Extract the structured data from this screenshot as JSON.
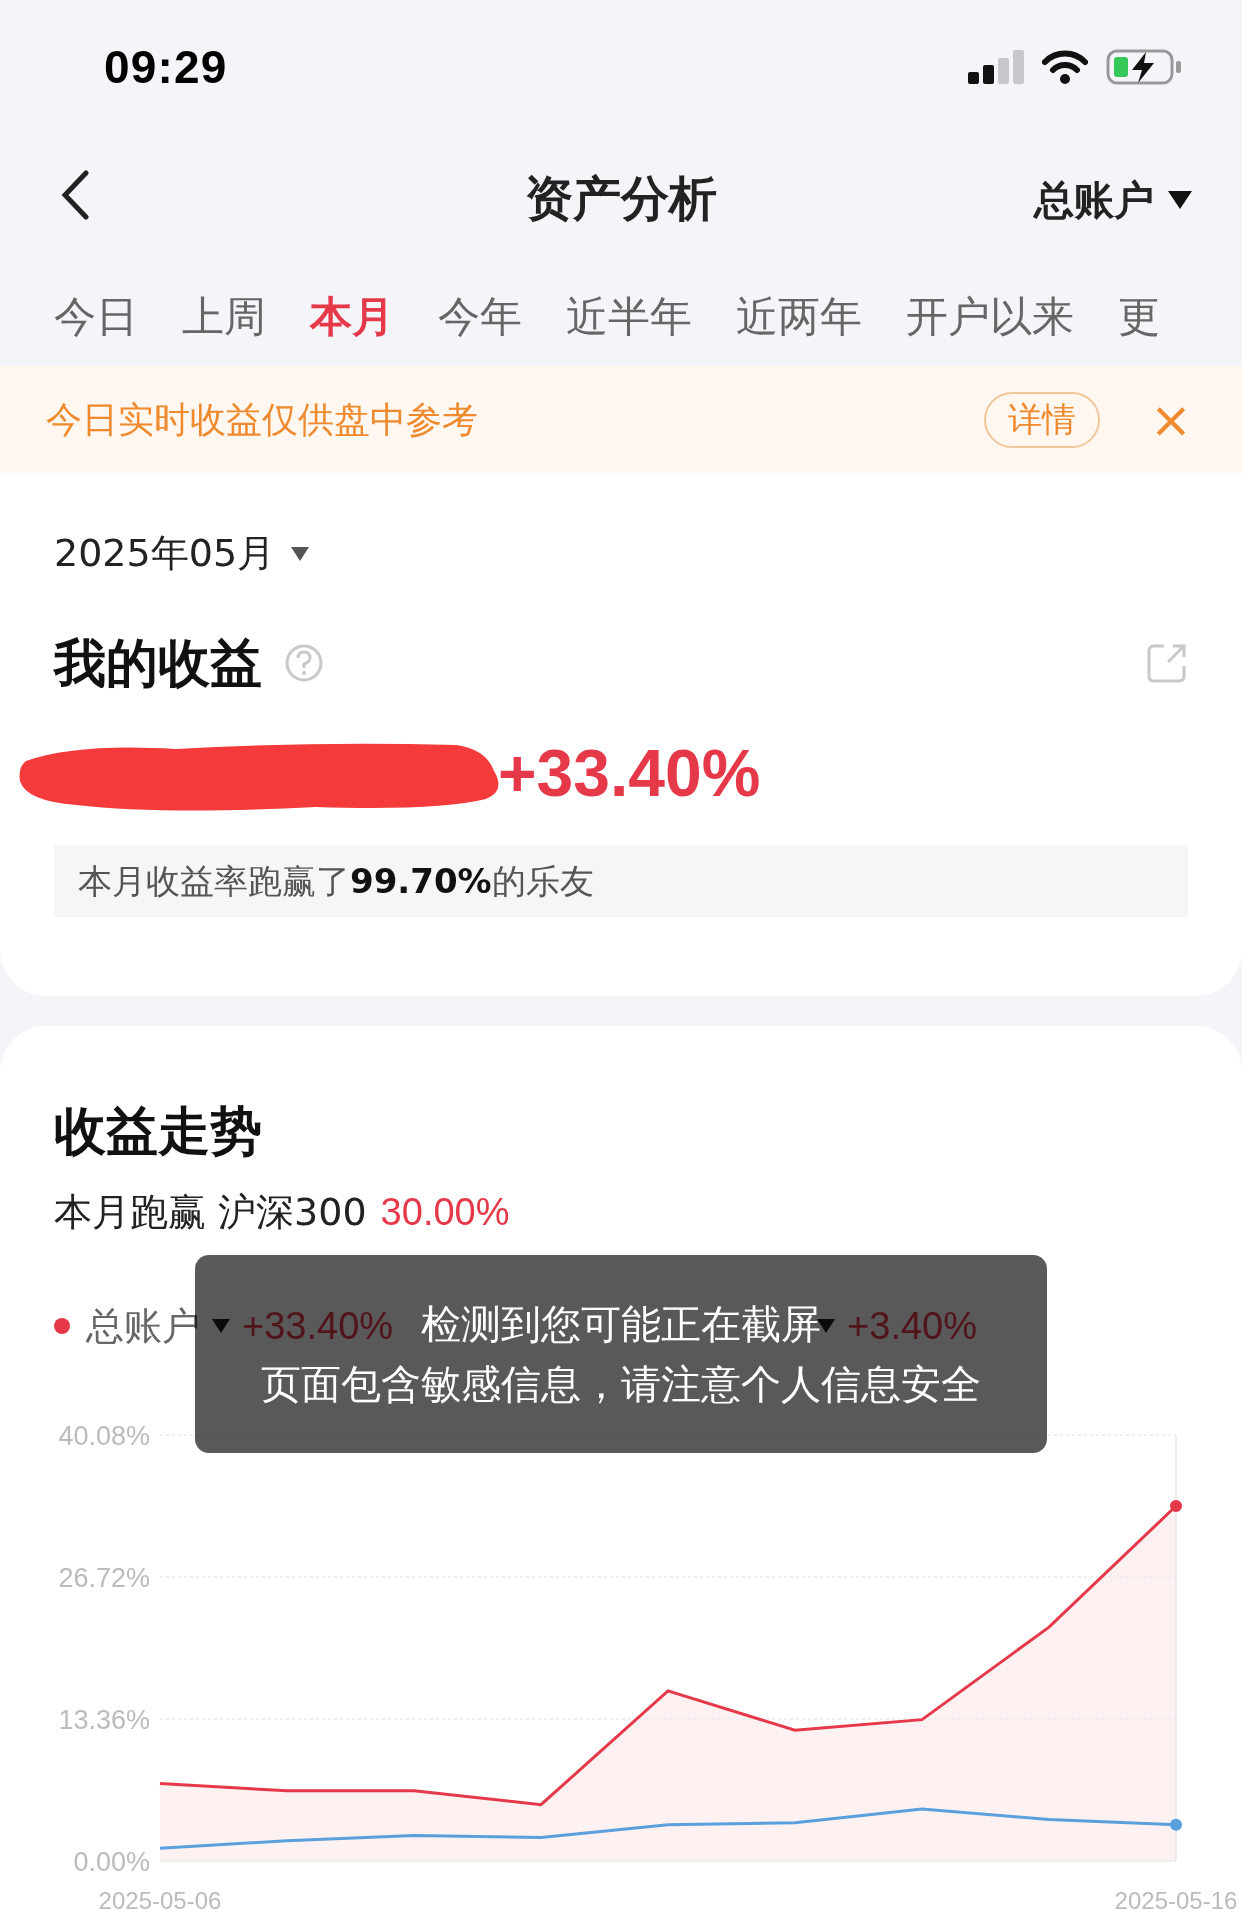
{
  "status_bar": {
    "time": "09:29"
  },
  "nav": {
    "title": "资产分析",
    "account": "总账户"
  },
  "tabs": [
    {
      "label": "今日",
      "selected": false
    },
    {
      "label": "上周",
      "selected": false
    },
    {
      "label": "本月",
      "selected": true
    },
    {
      "label": "今年",
      "selected": false
    },
    {
      "label": "近半年",
      "selected": false
    },
    {
      "label": "近两年",
      "selected": false
    },
    {
      "label": "开户以来",
      "selected": false
    },
    {
      "label": "更",
      "selected": false
    }
  ],
  "notice": {
    "text": "今日实时收益仅供盘中参考",
    "button": "详情",
    "close": "×"
  },
  "summary": {
    "period": "2025年05月",
    "title": "我的收益",
    "return": "+33.40%",
    "rank_text": "本月收益率跑赢了**99.70%**的乐友"
  },
  "trend": {
    "title": "收益走势",
    "subtitle_label": "本月跑赢 沪深300",
    "subtitle_value": "30.00%",
    "legend": [
      {
        "name": "总账户",
        "value": "+33.40%",
        "color": "#e5394a"
      },
      {
        "value": "+3.40%"
      }
    ],
    "toast": {
      "lines": [
        "检测到您可能正在截屏",
        "页面包含敏感信息，请注意个人信息安全"
      ]
    },
    "chart_data": {
      "type": "line",
      "categories": [
        "2025-05-06",
        null,
        null,
        null,
        null,
        null,
        null,
        null,
        "2025-05-16"
      ],
      "ylim": [
        0,
        40.08
      ],
      "yticks": [
        {
          "value": 0,
          "label": "0.00%"
        },
        {
          "value": 13.36,
          "label": "13.36%"
        },
        {
          "value": 26.72,
          "label": "26.72%"
        },
        {
          "value": 40.08,
          "label": "40.08%"
        }
      ],
      "series": [
        {
          "color": "#e5394a",
          "values": [
            7.3,
            6.6,
            6.6,
            5.3,
            16.0,
            12.3,
            13.3,
            22.0,
            33.4
          ]
        },
        {
          "color": "#5aa0dc",
          "values": [
            1.2,
            1.9,
            2.4,
            2.2,
            3.4,
            3.6,
            4.9,
            3.9,
            3.4
          ]
        }
      ]
    }
  }
}
